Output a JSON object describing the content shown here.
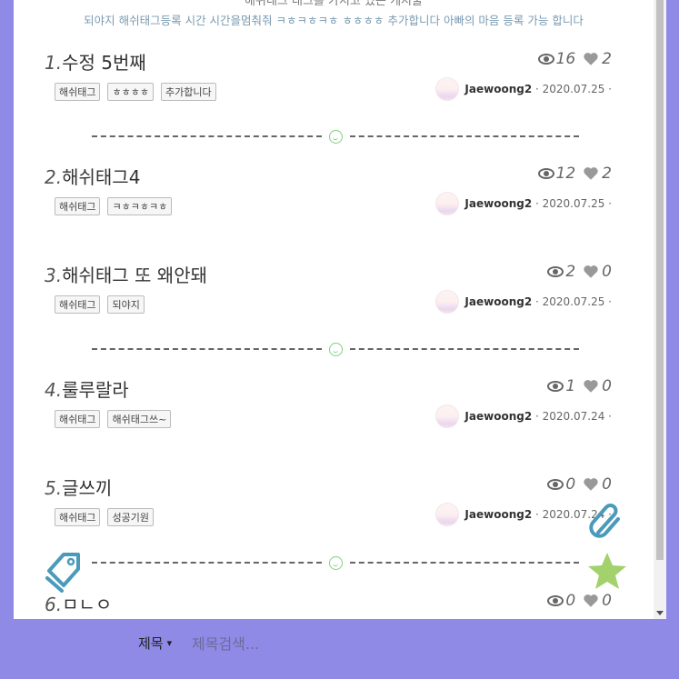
{
  "header": {
    "title_partial": "해쉬태그 태그를 가지고 있는 게시물",
    "description": "되야지 해쉬태그등록 시간 시간을멈춰줘 ㅋㅎㅋㅎㅋㅎ ㅎㅎㅎㅎ 추가합니다 아빠의 마음 등록 가능 합니다"
  },
  "posts": [
    {
      "num": "1",
      "title": "수정 5번째",
      "views": "16",
      "likes": "2",
      "tags": [
        "해쉬태그",
        "ㅎㅎㅎㅎ",
        "추가합니다"
      ],
      "author": "Jaewoong2",
      "date": "2020.07.25"
    },
    {
      "num": "2",
      "title": "해쉬태그4",
      "views": "12",
      "likes": "2",
      "tags": [
        "해쉬태그",
        "ㅋㅎㅋㅎㅋㅎ"
      ],
      "author": "Jaewoong2",
      "date": "2020.07.25"
    },
    {
      "num": "3",
      "title": "해쉬태그 또 왜안돼",
      "views": "2",
      "likes": "0",
      "tags": [
        "해쉬태그",
        "되야지"
      ],
      "author": "Jaewoong2",
      "date": "2020.07.25"
    },
    {
      "num": "4",
      "title": "룰루랄라",
      "views": "1",
      "likes": "0",
      "tags": [
        "해쉬태그",
        "해쉬태그쓰~"
      ],
      "author": "Jaewoong2",
      "date": "2020.07.24"
    },
    {
      "num": "5",
      "title": "글쓰끼",
      "views": "0",
      "likes": "0",
      "tags": [
        "해쉬태그",
        "성공기원"
      ],
      "author": "Jaewoong2",
      "date": "2020.07.24"
    },
    {
      "num": "6",
      "title": "ㅁㄴㅇ",
      "views": "0",
      "likes": "0",
      "tags": [],
      "author": "",
      "date": ""
    }
  ],
  "search": {
    "select_value": "제목",
    "placeholder": "제목검색..."
  },
  "colors": {
    "background": "#8f8ae6",
    "divider_smile": "#7ed27e",
    "star": "#a3d16b",
    "tag_icon": "#4a9aba"
  },
  "icons": [
    "eye-icon",
    "heart-icon",
    "smile-icon",
    "paperclip-icon",
    "star-icon",
    "tag-icon",
    "chevron-down-icon"
  ]
}
